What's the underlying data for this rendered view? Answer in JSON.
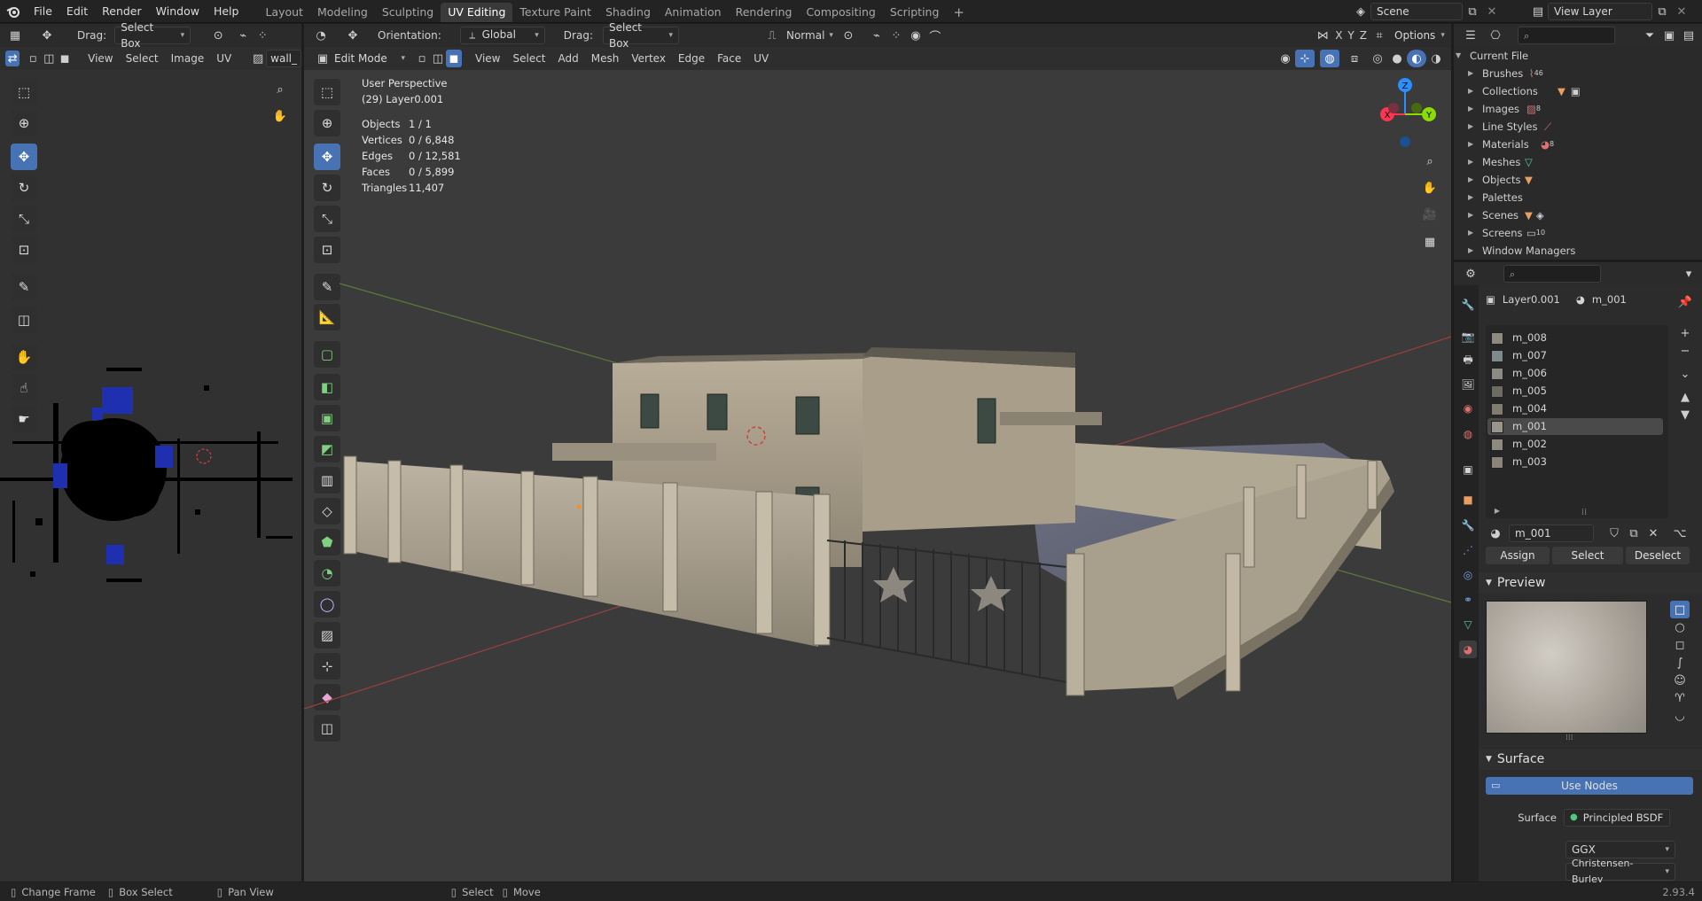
{
  "topbar": {
    "menus": [
      "File",
      "Edit",
      "Render",
      "Window",
      "Help"
    ],
    "workspaces": [
      "Layout",
      "Modeling",
      "Sculpting",
      "UV Editing",
      "Texture Paint",
      "Shading",
      "Animation",
      "Rendering",
      "Compositing",
      "Scripting"
    ],
    "active_workspace": "UV Editing",
    "add_tab": "+",
    "scene_name": "Scene",
    "view_layer": "View Layer"
  },
  "uv_editor": {
    "drag_label": "Drag:",
    "drag_value": "Select Box",
    "menus": [
      "View",
      "Select",
      "Image",
      "UV"
    ],
    "image_name": "wall_"
  },
  "viewport": {
    "orientation_label": "Orientation:",
    "orientation_value": "Global",
    "drag_label": "Drag:",
    "drag_value": "Select Box",
    "pivot_value": "Normal",
    "axis_x": "X",
    "axis_y": "Y",
    "axis_z": "Z",
    "options_label": "Options",
    "mode": "Edit Mode",
    "menus": [
      "View",
      "Select",
      "Add",
      "Mesh",
      "Vertex",
      "Edge",
      "Face",
      "UV"
    ],
    "overlay_title": "User Perspective",
    "overlay_subtitle": "(29) Layer0.001",
    "stats": [
      {
        "label": "Objects",
        "value": "1 / 1"
      },
      {
        "label": "Vertices",
        "value": "0 / 6,848"
      },
      {
        "label": "Edges",
        "value": "0 / 12,581"
      },
      {
        "label": "Faces",
        "value": "0 / 5,899"
      },
      {
        "label": "Triangles",
        "value": "11,407"
      }
    ],
    "gizmo": {
      "x": "X",
      "y": "Y",
      "z": "Z"
    }
  },
  "outliner": {
    "root": "Current File",
    "items": [
      {
        "label": "Brushes",
        "count": "46"
      },
      {
        "label": "Collections",
        "count": ""
      },
      {
        "label": "Images",
        "count": "8"
      },
      {
        "label": "Line Styles",
        "count": ""
      },
      {
        "label": "Materials",
        "count": "8"
      },
      {
        "label": "Meshes",
        "count": ""
      },
      {
        "label": "Objects",
        "count": ""
      },
      {
        "label": "Palettes",
        "count": ""
      },
      {
        "label": "Scenes",
        "count": ""
      },
      {
        "label": "Screens",
        "count": "10"
      },
      {
        "label": "Window Managers",
        "count": ""
      }
    ]
  },
  "properties": {
    "object_name": "Layer0.001",
    "material_name": "m_001",
    "slots": [
      "m_008",
      "m_007",
      "m_006",
      "m_005",
      "m_004",
      "m_001",
      "m_002",
      "m_003"
    ],
    "selected_slot": "m_001",
    "slot_colors": [
      "#8d8a80",
      "#7f8a8d",
      "#8c8a84",
      "#6e6c62",
      "#807c70",
      "#9a958c",
      "#8e8a80",
      "#8a847a"
    ],
    "mat_field": "m_001",
    "assign": "Assign",
    "select": "Select",
    "deselect": "Deselect",
    "preview_title": "Preview",
    "surface_title": "Surface",
    "use_nodes": "Use Nodes",
    "surface_label": "Surface",
    "surface_value": "Principled BSDF",
    "distribution": "GGX",
    "subsurface": "Christensen-Burley"
  },
  "statusbar": {
    "items": [
      "Change Frame",
      "Box Select",
      "Pan View",
      "Select",
      "Move"
    ],
    "version": "2.93.4"
  },
  "colors": {
    "accent": "#4772b3",
    "x_axis": "#ff3352",
    "y_axis": "#8bdc00",
    "z_axis": "#2890ff"
  }
}
